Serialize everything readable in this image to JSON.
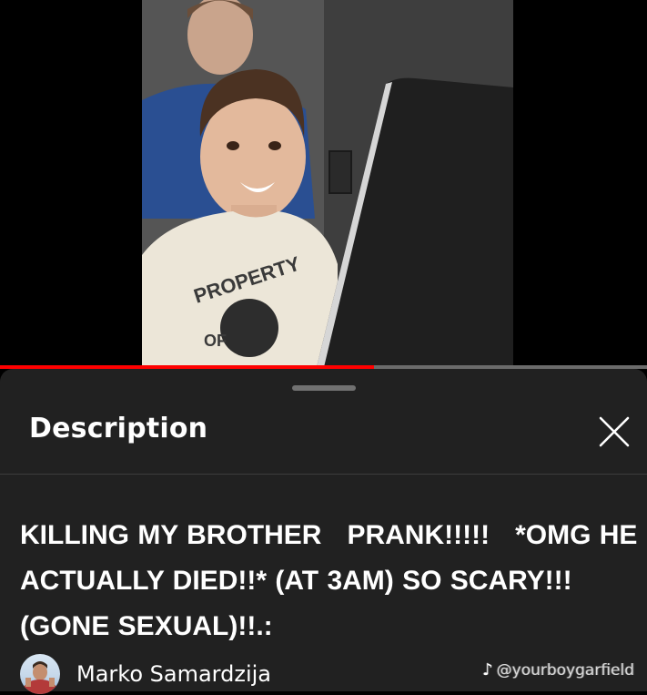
{
  "player": {
    "progress_fraction": 0.578,
    "colors": {
      "progress_played": "#ff0000",
      "progress_track": "#6b6b6b"
    },
    "frame_content": "video-frame-kid-laptop"
  },
  "description_panel": {
    "title": "Description",
    "close_icon": "close-x-icon",
    "video_title": "KILLING MY BROTHER   PRANK!!!!!   *OMG HE ACTUALLY DIED!!* (AT 3AM) SO SCARY!!! (GONE SEXUAL)!!.:",
    "channel": {
      "name": "Marko Samardzija",
      "avatar_icon": "channel-avatar-icon"
    }
  },
  "watermark": {
    "text": "@yourboygarfield",
    "icon": "tiktok-icon"
  }
}
